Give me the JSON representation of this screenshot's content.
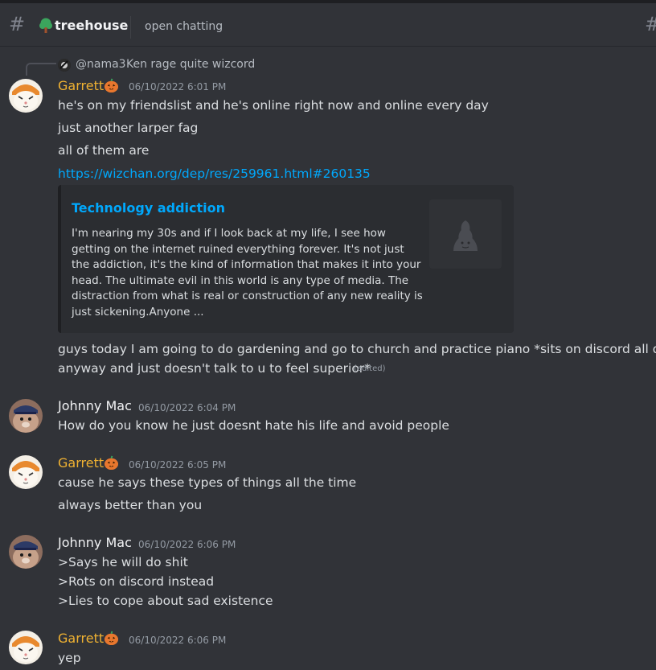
{
  "header": {
    "channel": "treehouse",
    "topic": "open chatting"
  },
  "reply": {
    "user": "@nama3",
    "text": "Ken rage quite wizcord"
  },
  "messages": [
    {
      "author": "Garrett",
      "timestamp": "06/10/2022 6:01 PM",
      "lines": [
        "he's on my friendslist and he's online right now and online every day",
        "just another larper fag",
        "all of them are"
      ],
      "link": "https://wizchan.org/dep/res/259961.html#260135",
      "embed": {
        "title": "Technology addiction",
        "description": "I'm nearing my 30s and if I look back at my life, I see how getting on the internet ruined everything forever. It's not just the addiction, it's the kind of information that makes it into your head. The ultimate evil in this world is any type of media. The distraction from what is real or construction of any new reality is just sickening.Anyone ..."
      },
      "after_embed": {
        "line1": "guys today I am going to do gardening and go to church and practice piano  *sits on discord all day",
        "line2": "anyway and just doesn't talk to u to feel superior*",
        "edited": "(edited)"
      }
    },
    {
      "author": "Johnny Mac",
      "timestamp": "06/10/2022 6:04 PM",
      "lines": [
        "How do you know he just doesnt hate his life and avoid people"
      ]
    },
    {
      "author": "Garrett",
      "timestamp": "06/10/2022 6:05 PM",
      "lines": [
        "cause he says these types of things all the time",
        "always better than you"
      ]
    },
    {
      "author": "Johnny Mac",
      "timestamp": "06/10/2022 6:06 PM",
      "lines": [
        ">Says he will do shit",
        ">Rots on discord instead",
        ">Lies to cope about sad existence"
      ]
    },
    {
      "author": "Garrett",
      "timestamp": "06/10/2022 6:06 PM",
      "lines": [
        "yep"
      ]
    }
  ],
  "colors": {
    "background": "#313338",
    "garrett_name": "#f0b232",
    "link": "#00a8fc",
    "embed_bg": "#2b2d31"
  },
  "icons": {
    "channel": "hash-icon",
    "server": "tree-icon",
    "badge": "pumpkin-icon",
    "threads": "threads-icon"
  }
}
